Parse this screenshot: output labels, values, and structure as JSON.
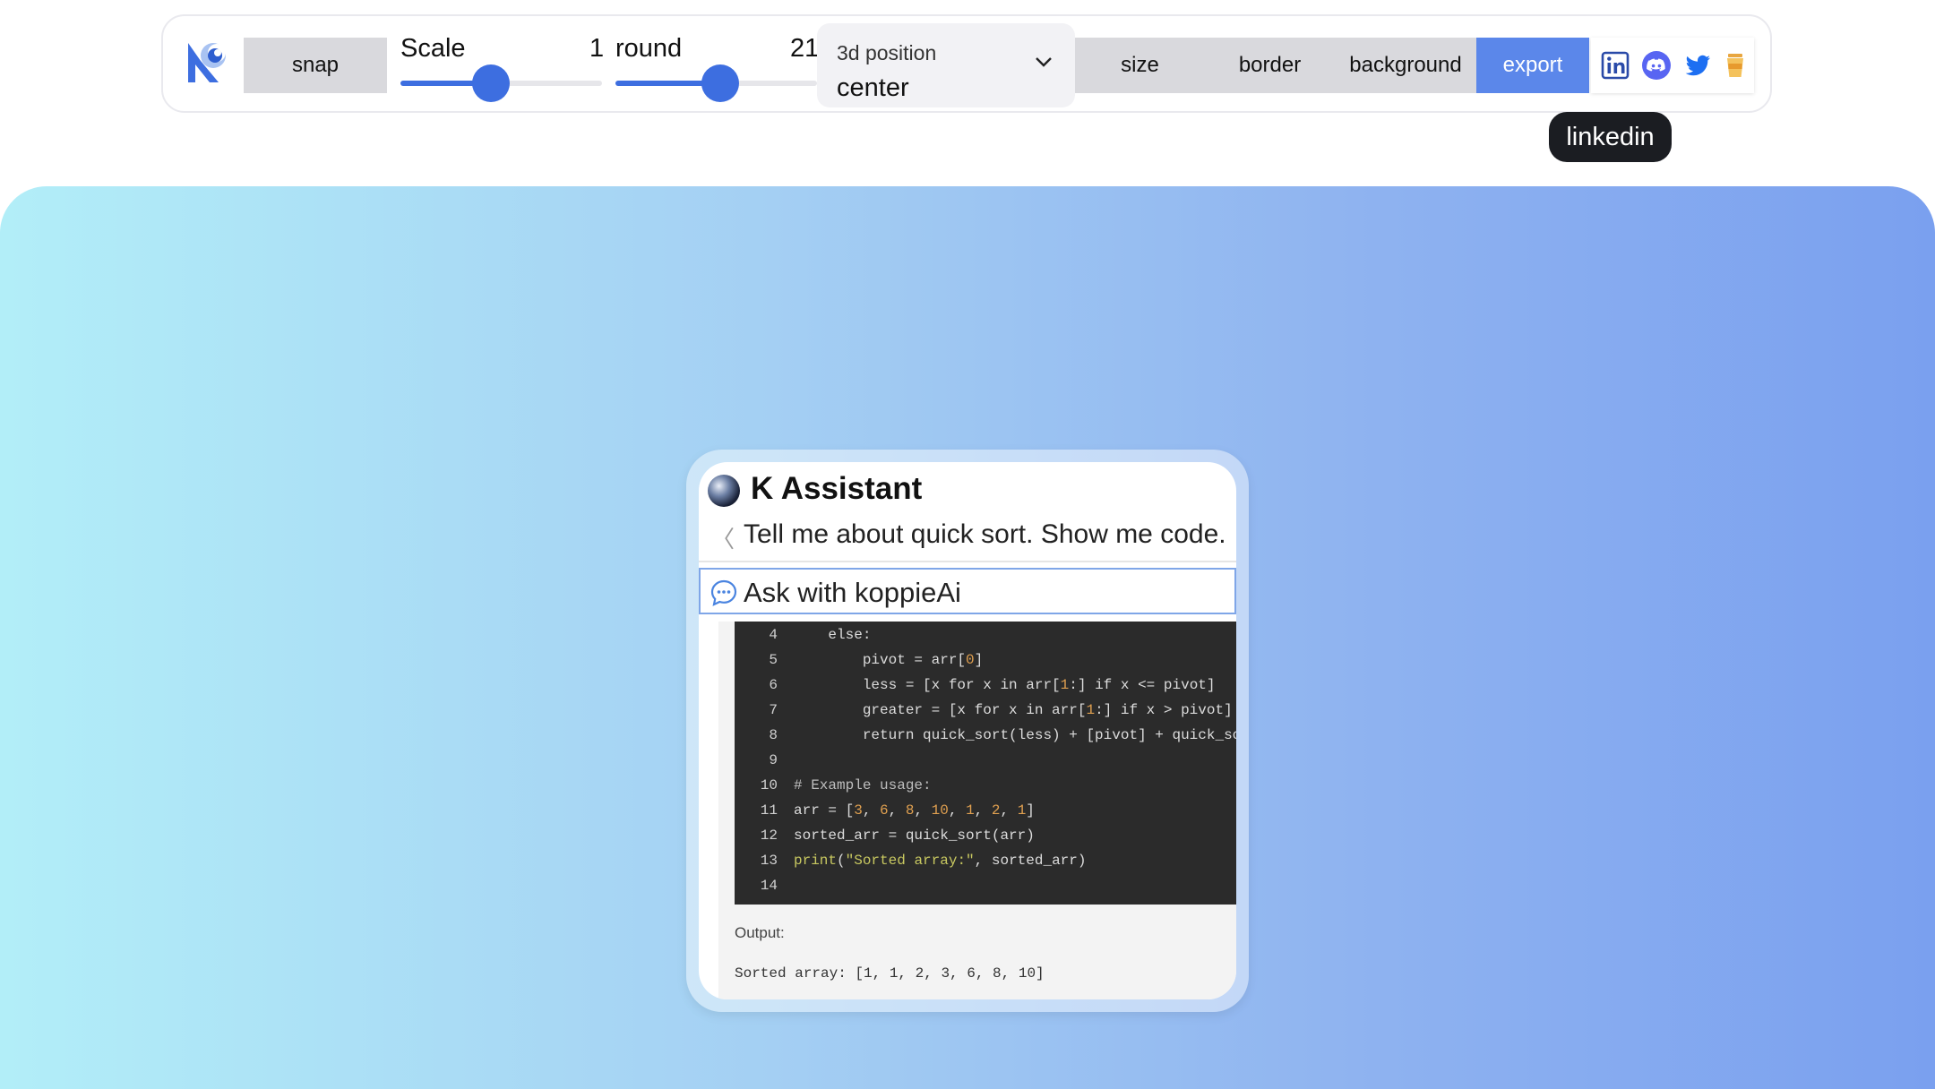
{
  "toolbar": {
    "snap_label": "snap",
    "scale": {
      "label": "Scale",
      "value": "1",
      "fraction": 0.45
    },
    "round": {
      "label": "round",
      "value": "21",
      "fraction": 0.52
    },
    "position": {
      "label": "3d position",
      "value": "center"
    },
    "size_label": "size",
    "border_label": "border",
    "background_label": "background",
    "export_label": "export",
    "tooltip": "linkedin"
  },
  "colors": {
    "accent": "#3d6ee0",
    "export": "#5b87ea",
    "gradient_start": "#b2eef8",
    "gradient_end": "#7aa0ef"
  },
  "card": {
    "title": "K Assistant",
    "question": "Tell me about quick sort. Show me code.",
    "ask_label": "Ask with koppieAi",
    "code_lines": [
      {
        "n": "4",
        "code": "    else:"
      },
      {
        "n": "5",
        "code": "        pivot = arr[0]"
      },
      {
        "n": "6",
        "code": "        less = [x for x in arr[1:] if x <= pivot]"
      },
      {
        "n": "7",
        "code": "        greater = [x for x in arr[1:] if x > pivot]"
      },
      {
        "n": "8",
        "code": "        return quick_sort(less) + [pivot] + quick_sort(g"
      },
      {
        "n": "9",
        "code": ""
      },
      {
        "n": "10",
        "code": "# Example usage:"
      },
      {
        "n": "11",
        "code": "arr = [3, 6, 8, 10, 1, 2, 1]"
      },
      {
        "n": "12",
        "code": "sorted_arr = quick_sort(arr)"
      },
      {
        "n": "13",
        "code": "print(\"Sorted array:\", sorted_arr)"
      },
      {
        "n": "14",
        "code": ""
      }
    ],
    "output_label": "Output:",
    "output_text": "Sorted array: [1, 1, 2, 3, 6, 8, 10]"
  },
  "icons": [
    "app-logo-icon",
    "chevron-down-icon",
    "linkedin-icon",
    "discord-icon",
    "twitter-icon",
    "coffee-cup-icon",
    "chat-bubble-icon",
    "avatar"
  ]
}
